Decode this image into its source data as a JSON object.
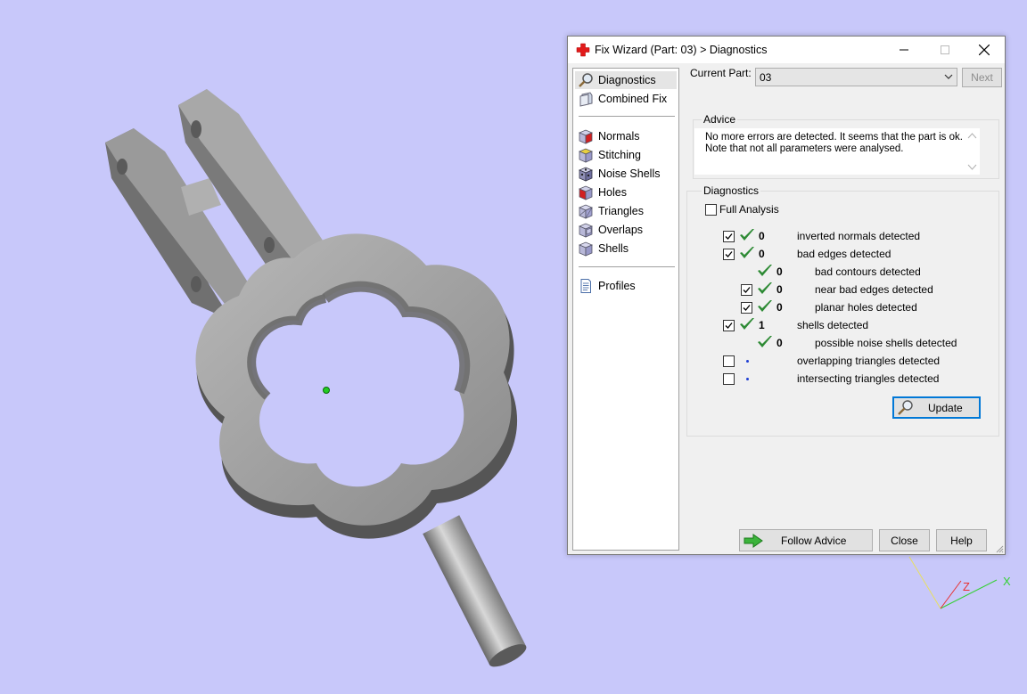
{
  "dialog": {
    "title": "Fix Wizard (Part: 03) > Diagnostics",
    "nav": {
      "top_items": [
        {
          "label": "Diagnostics",
          "icon": "magnifier-icon",
          "active": true
        },
        {
          "label": "Combined Fix",
          "icon": "combined-fix-icon"
        }
      ],
      "fix_items": [
        {
          "label": "Normals",
          "icon": "normals-cube-icon"
        },
        {
          "label": "Stitching",
          "icon": "stitching-cube-icon"
        },
        {
          "label": "Noise Shells",
          "icon": "noise-shells-cube-icon"
        },
        {
          "label": "Holes",
          "icon": "holes-cube-icon"
        },
        {
          "label": "Triangles",
          "icon": "triangles-cube-icon"
        },
        {
          "label": "Overlaps",
          "icon": "overlaps-cube-icon"
        },
        {
          "label": "Shells",
          "icon": "shells-cube-icon"
        }
      ],
      "bottom_items": [
        {
          "label": "Profiles",
          "icon": "document-icon"
        }
      ]
    },
    "current_part": {
      "label": "Current Part:",
      "value": "03"
    },
    "next_button": "Next",
    "advice": {
      "title": "Advice",
      "line1": "No more errors are detected. It seems that the part is ok.",
      "line2": "Note that not all parameters were analysed."
    },
    "diagnostics": {
      "title": "Diagnostics",
      "full_analysis_label": "Full Analysis",
      "full_analysis_checked": false,
      "rows": [
        {
          "label": "inverted normals detected",
          "count": "0",
          "checked": true,
          "has_checkbox": true,
          "status": "ok"
        },
        {
          "label": "bad edges detected",
          "count": "0",
          "checked": true,
          "has_checkbox": true,
          "status": "ok"
        },
        {
          "label": "bad contours detected",
          "count": "0",
          "has_checkbox": false,
          "status": "ok"
        },
        {
          "label": "near bad edges detected",
          "count": "0",
          "checked": true,
          "has_checkbox": true,
          "status": "ok"
        },
        {
          "label": "planar holes detected",
          "count": "0",
          "checked": true,
          "has_checkbox": true,
          "status": "ok"
        },
        {
          "label": "shells detected",
          "count": "1",
          "checked": true,
          "has_checkbox": true,
          "status": "ok"
        },
        {
          "label": "possible noise shells detected",
          "count": "0",
          "has_checkbox": false,
          "status": "ok"
        },
        {
          "label": "overlapping triangles detected",
          "count": "",
          "checked": false,
          "has_checkbox": true,
          "status": "not-analysed"
        },
        {
          "label": "intersecting triangles detected",
          "count": "",
          "checked": false,
          "has_checkbox": true,
          "status": "not-analysed"
        }
      ],
      "update_button": "Update"
    },
    "footer": {
      "follow_advice": "Follow Advice",
      "close": "Close",
      "help": "Help"
    }
  },
  "axes": {
    "x_label": "X",
    "z_label": "Z"
  },
  "colors": {
    "viewport_bg": "#c8c8fa",
    "part_gray": "#8c8c8c",
    "check_green": "#2d8a34",
    "x_axis": "#35d035",
    "z_axis": "#e83030",
    "y_axis": "#e8e060"
  }
}
